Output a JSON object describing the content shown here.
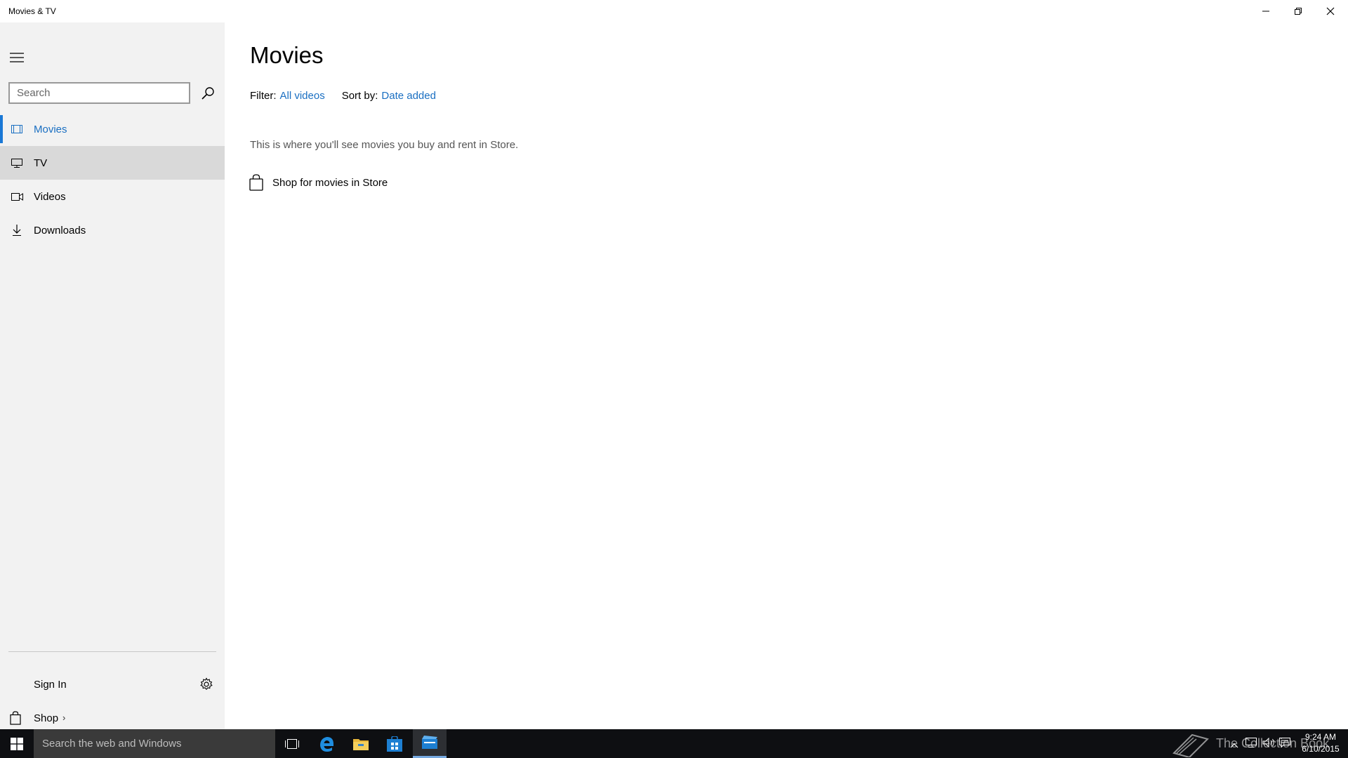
{
  "window": {
    "title": "Movies & TV"
  },
  "sidebar": {
    "search_placeholder": "Search",
    "items": [
      {
        "label": "Movies",
        "icon": "film-icon",
        "active": true
      },
      {
        "label": "TV",
        "icon": "monitor-icon"
      },
      {
        "label": "Videos",
        "icon": "video-camera-icon"
      },
      {
        "label": "Downloads",
        "icon": "download-icon"
      }
    ],
    "sign_in_label": "Sign In",
    "shop_label": "Shop",
    "shop_chevron": "›"
  },
  "main": {
    "title": "Movies",
    "filter_label": "Filter:",
    "filter_value": "All videos",
    "sort_label": "Sort by:",
    "sort_value": "Date added",
    "empty_message": "This is where you'll see movies you buy and rent in Store.",
    "shop_link_label": "Shop for movies in Store"
  },
  "taskbar": {
    "search_placeholder": "Search the web and Windows",
    "watermark_text": "The Collection Book",
    "time": "9:24 AM",
    "date": "6/10/2015"
  },
  "colors": {
    "accent": "#1a6fc2",
    "sidebar_bg": "#f2f2f2",
    "hover_bg": "#d9d9d9",
    "taskbar_bg": "#0e0f12"
  }
}
